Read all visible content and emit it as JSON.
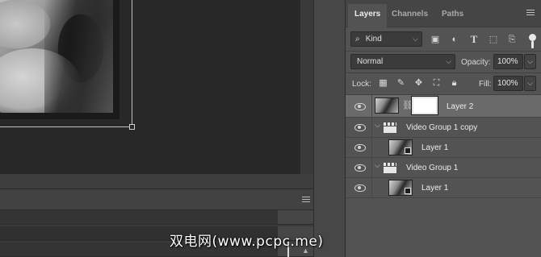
{
  "layers_panel": {
    "tabs": [
      {
        "label": "Layers",
        "active": true
      },
      {
        "label": "Channels",
        "active": false
      },
      {
        "label": "Paths",
        "active": false
      }
    ],
    "filter": {
      "kind_label": "Kind",
      "icons": [
        "image-filter-icon",
        "adjustment-filter-icon",
        "type-filter-icon",
        "shape-filter-icon",
        "smart-object-filter-icon"
      ],
      "filter_toggle": "on"
    },
    "blend_mode": "Normal",
    "opacity_label": "Opacity:",
    "opacity_value": "100%",
    "lock_label": "Lock:",
    "lock_icons": [
      "lock-transparent-icon",
      "lock-image-icon",
      "lock-position-icon",
      "lock-artboard-icon",
      "lock-all-icon"
    ],
    "fill_label": "Fill:",
    "fill_value": "100%",
    "layers": [
      {
        "name": "Layer 2",
        "type": "layer-with-mask",
        "selected": true,
        "visible": true
      },
      {
        "name": "Video Group 1 copy",
        "type": "video-group",
        "expanded": true,
        "visible": true
      },
      {
        "name": "Layer 1",
        "type": "video-layer",
        "indent": true,
        "visible": true
      },
      {
        "name": "Video Group 1",
        "type": "video-group",
        "expanded": true,
        "visible": true
      },
      {
        "name": "Layer 1",
        "type": "video-layer",
        "indent": true,
        "visible": true
      }
    ]
  },
  "watermark": "双电网(www.pcpc.me)",
  "colors": {
    "panel_bg": "#535353",
    "selected_row": "#6a6a6a",
    "canvas_bg": "#282828",
    "text": "#ececec"
  }
}
